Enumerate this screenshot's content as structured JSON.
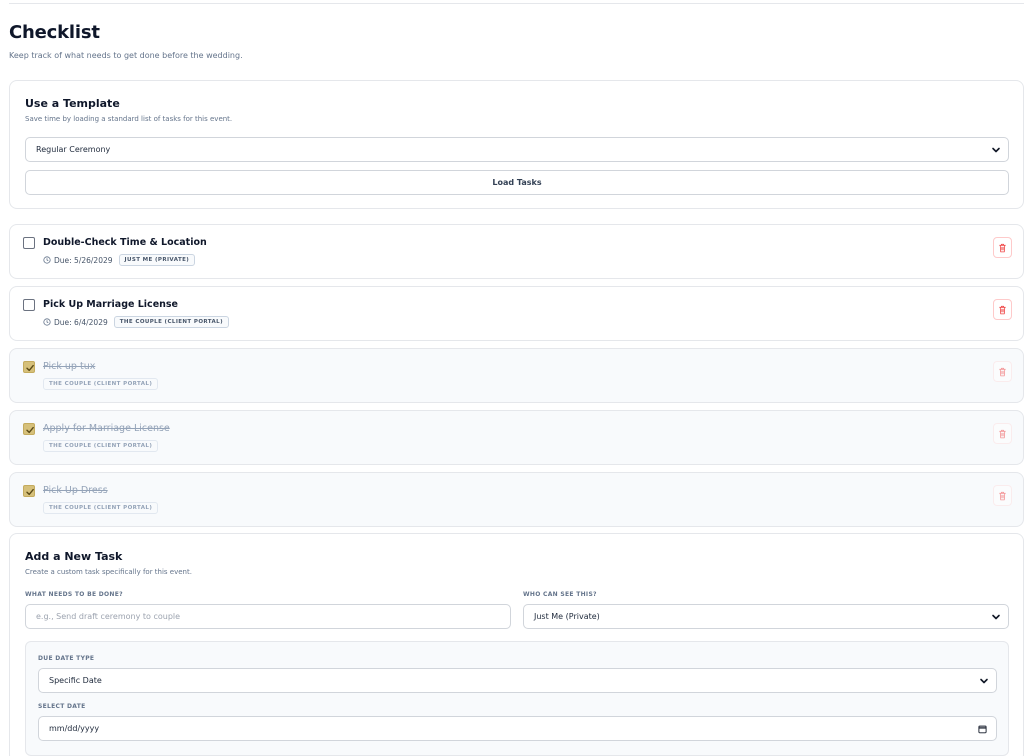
{
  "page": {
    "title": "Checklist",
    "subtitle": "Keep track of what needs to get done before the wedding."
  },
  "template": {
    "title": "Use a Template",
    "description": "Save time by loading a standard list of tasks for this event.",
    "selected": "Regular Ceremony",
    "load_label": "Load Tasks"
  },
  "tasks": [
    {
      "title": "Double-Check Time & Location",
      "due": "Due: 5/26/2029",
      "visibility": "JUST ME (PRIVATE)",
      "completed": false
    },
    {
      "title": "Pick Up Marriage License",
      "due": "Due: 6/4/2029",
      "visibility": "THE COUPLE (CLIENT PORTAL)",
      "completed": false
    },
    {
      "title": "Pick up tux",
      "due": "",
      "visibility": "THE COUPLE (CLIENT PORTAL)",
      "completed": true
    },
    {
      "title": "Apply for Marriage License",
      "due": "",
      "visibility": "THE COUPLE (CLIENT PORTAL)",
      "completed": true
    },
    {
      "title": "Pick Up Dress",
      "due": "",
      "visibility": "THE COUPLE (CLIENT PORTAL)",
      "completed": true
    }
  ],
  "add_task": {
    "title": "Add a New Task",
    "description": "Create a custom task specifically for this event.",
    "task_label": "WHAT NEEDS TO BE DONE?",
    "task_placeholder": "e.g., Send draft ceremony to couple",
    "visibility_label": "WHO CAN SEE THIS?",
    "visibility_selected": "Just Me (Private)",
    "due_type_label": "DUE DATE TYPE",
    "due_type_selected": "Specific Date",
    "date_label": "SELECT DATE",
    "date_placeholder": "mm/dd/yyyy"
  },
  "colors": {
    "checked": "#d6c07a",
    "delete": "#ef4444",
    "border": "#e5e7eb"
  },
  "icons": [
    "clock-icon",
    "trash-icon",
    "chevron-down-icon",
    "check-icon",
    "calendar-icon"
  ]
}
